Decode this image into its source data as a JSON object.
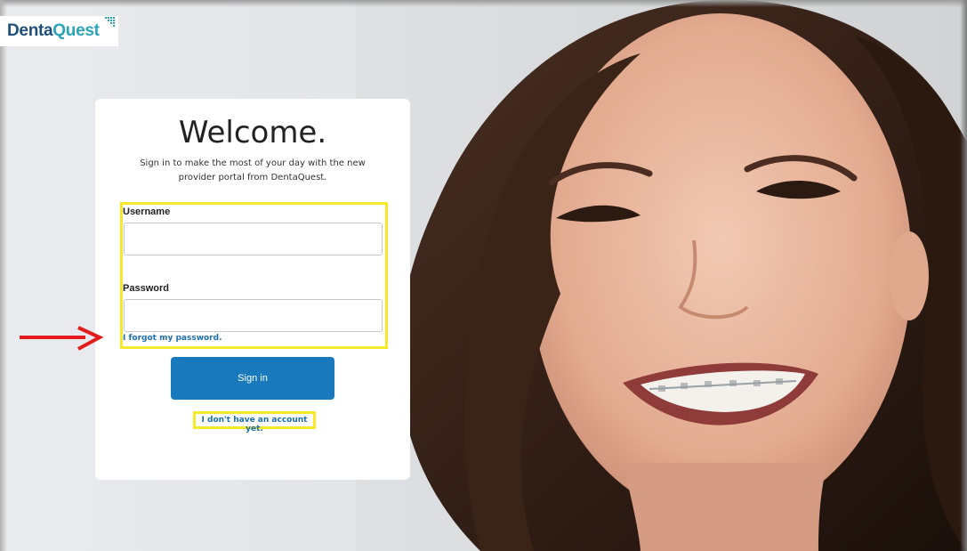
{
  "brand": {
    "logo_part1": "Denta",
    "logo_part2": "Quest",
    "logo_icon": "grid-dots-icon",
    "colors": {
      "navy": "#1d4f7a",
      "teal": "#2aa3b8"
    }
  },
  "login": {
    "title": "Welcome.",
    "subtitle": "Sign in to make the most of your day with the new provider portal from DentaQuest.",
    "username_label": "Username",
    "username_value": "",
    "password_label": "Password",
    "password_value": "",
    "forgot_link": "I forgot my password.",
    "signin_button": "Sign in",
    "no_account_link": "I don't have an account yet."
  },
  "annotations": {
    "highlight_color": "#f5e92a",
    "arrow_color": "#e31b1b",
    "arrow_icon": "right-arrow-icon"
  },
  "colors": {
    "button": "#1979bd",
    "link": "#1d6fb3"
  }
}
